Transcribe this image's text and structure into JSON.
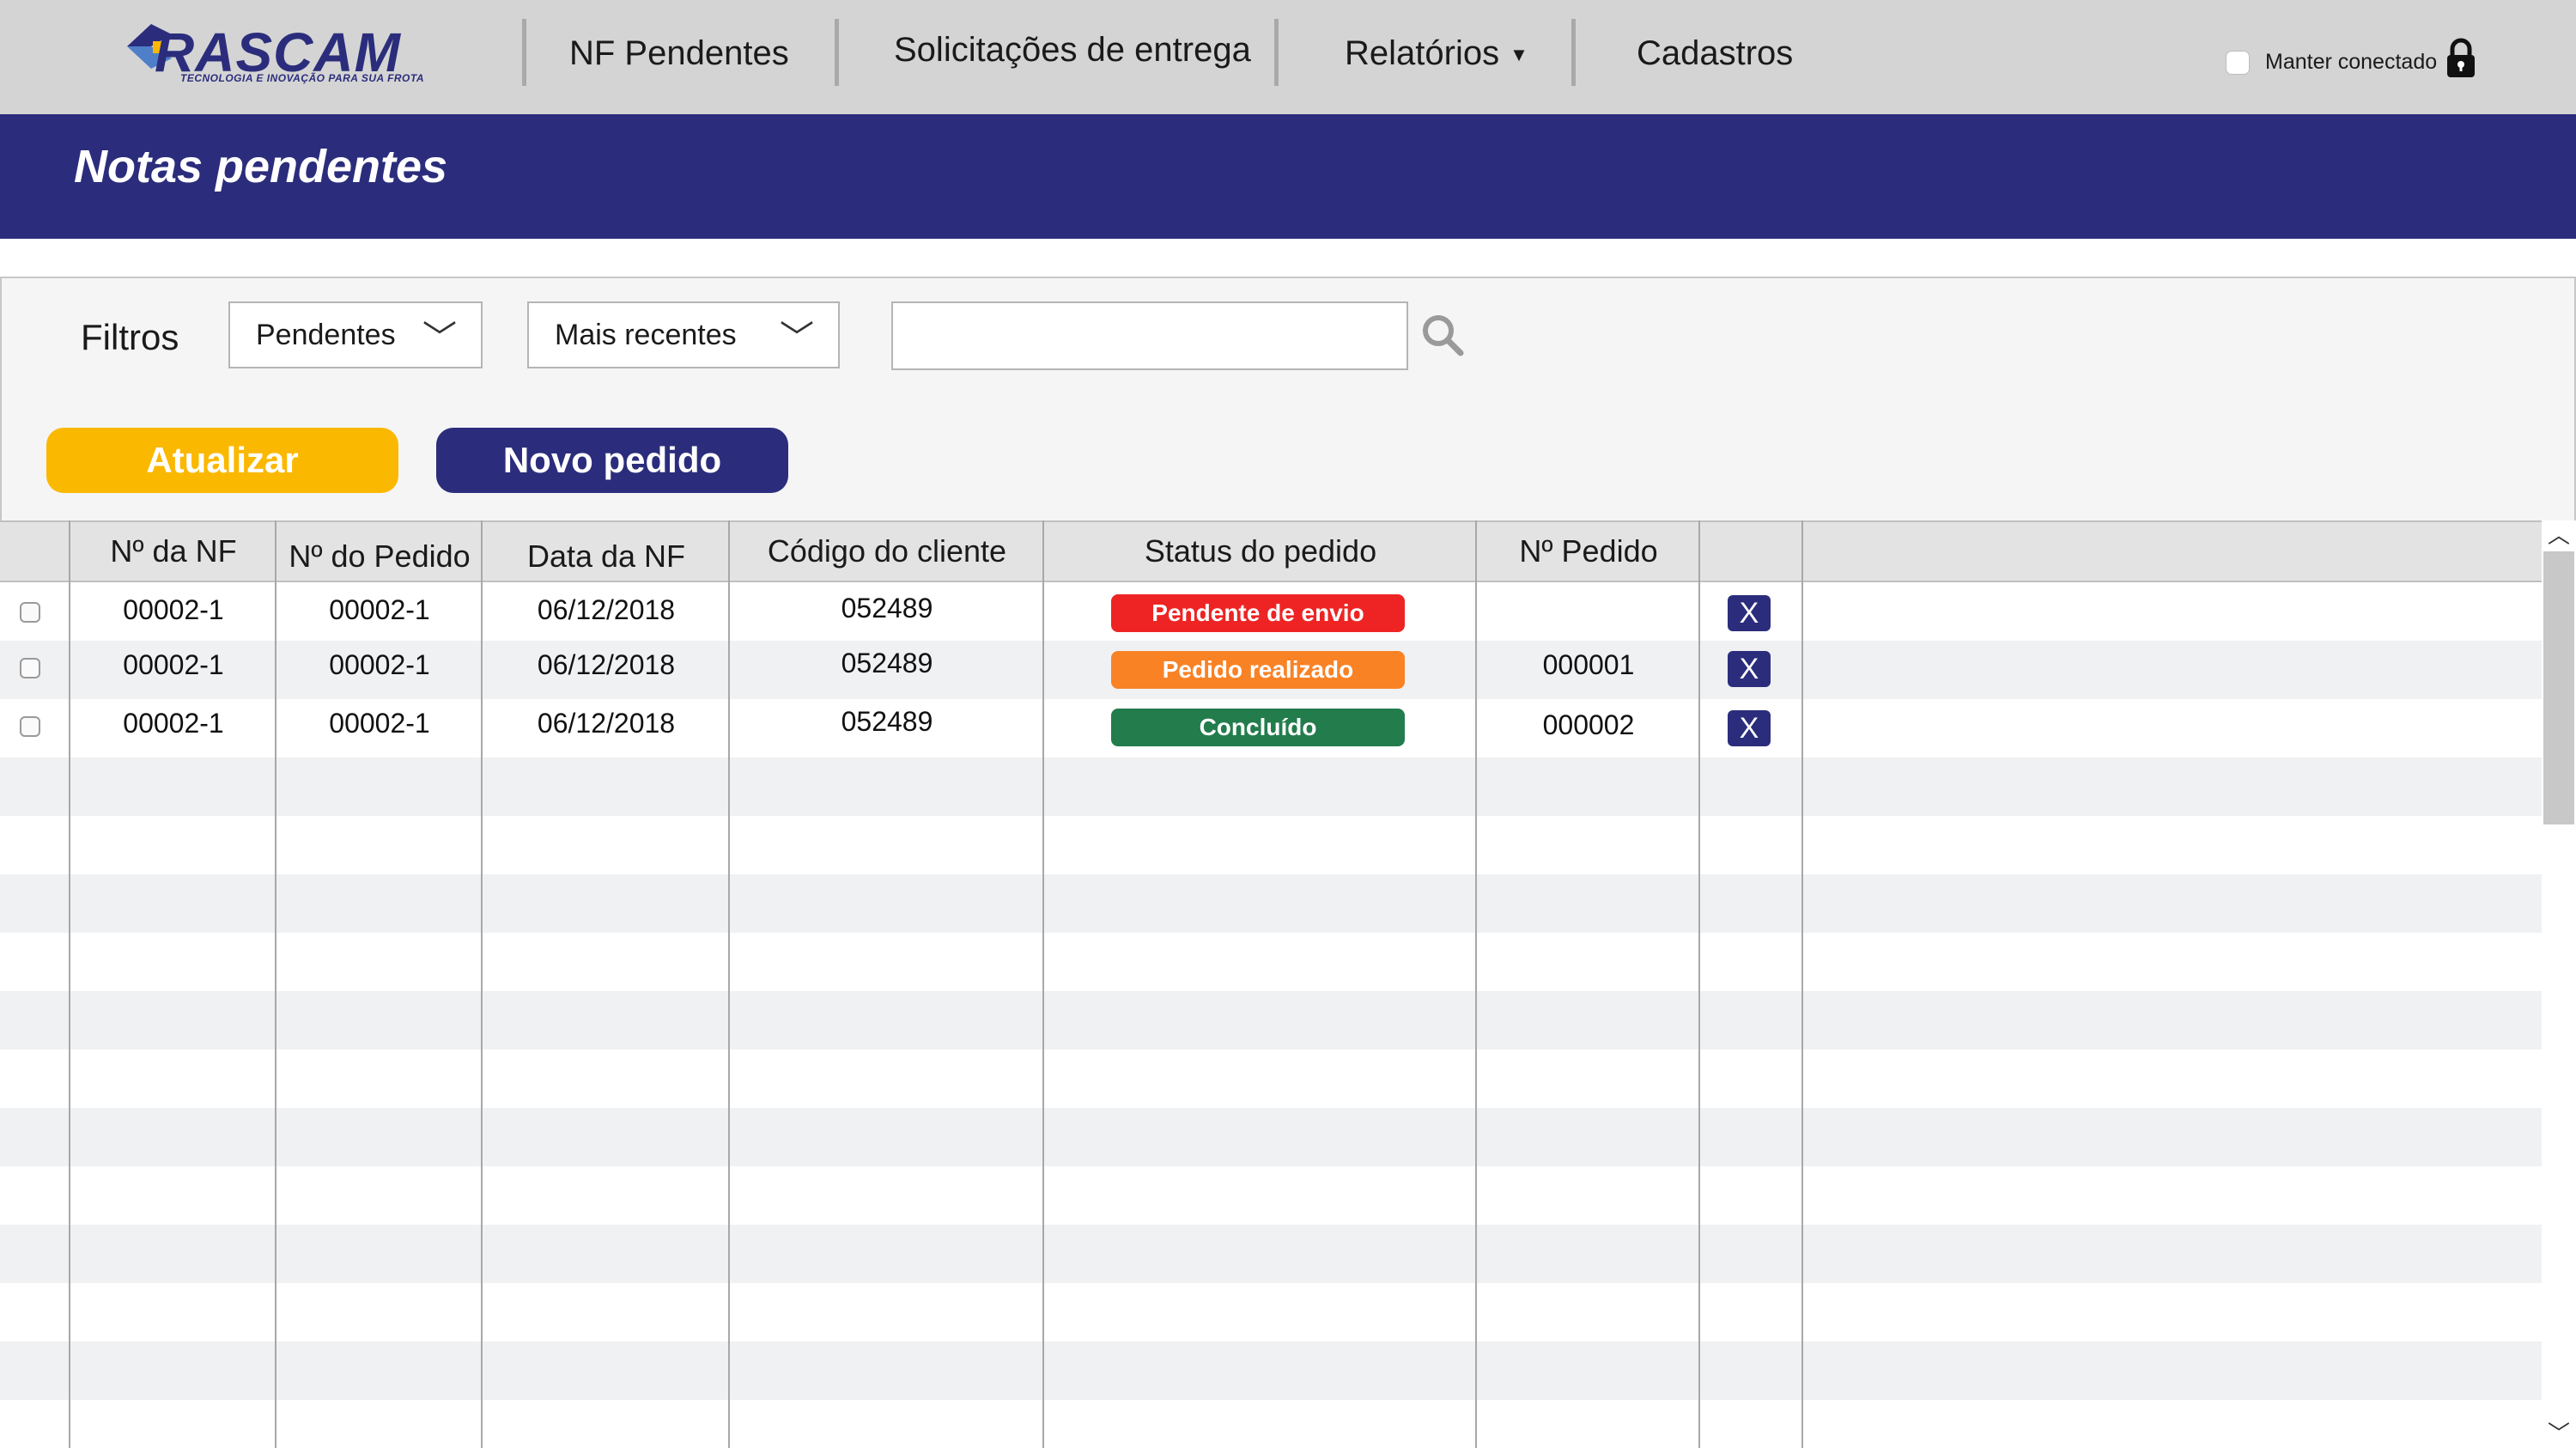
{
  "brand": {
    "name": "RASCAM",
    "tagline": "TECNOLOGIA E INOVAÇÃO PARA SUA FROTA"
  },
  "nav": {
    "items": [
      {
        "label": "NF Pendentes"
      },
      {
        "label": "Solicitações de entrega"
      },
      {
        "label": "Relatórios"
      },
      {
        "label": "Cadastros"
      }
    ],
    "keep_connected": "Manter conectado"
  },
  "page": {
    "title": "Notas pendentes"
  },
  "filters": {
    "label": "Filtros",
    "status_select": "Pendentes",
    "order_select": "Mais recentes",
    "search_value": ""
  },
  "actions": {
    "refresh_label": "Atualizar",
    "new_order_label": "Novo pedido"
  },
  "table": {
    "columns": [
      "Nº da NF",
      "Nº do Pedido",
      "Data da NF",
      "Código do cliente",
      "Status do pedido",
      "Nº Pedido"
    ],
    "rows": [
      {
        "nf": "00002-1",
        "pedido": "00002-1",
        "data": "06/12/2018",
        "cliente": "052489",
        "status": "Pendente de envio",
        "status_color": "#ee2424",
        "num_pedido": "",
        "remove": "X"
      },
      {
        "nf": "00002-1",
        "pedido": "00002-1",
        "data": "06/12/2018",
        "cliente": "052489",
        "status": "Pedido realizado",
        "status_color": "#f98225",
        "num_pedido": "000001",
        "remove": "X"
      },
      {
        "nf": "00002-1",
        "pedido": "00002-1",
        "data": "06/12/2018",
        "cliente": "052489",
        "status": "Concluído",
        "status_color": "#237c4c",
        "num_pedido": "000002",
        "remove": "X"
      }
    ]
  },
  "colors": {
    "primary": "#2b2d7c",
    "accent": "#fbb800",
    "topbar": "#d4d4d4"
  },
  "icons": {
    "search": "search-icon",
    "lock": "lock-icon",
    "dropdown": "chevron-down-icon"
  }
}
